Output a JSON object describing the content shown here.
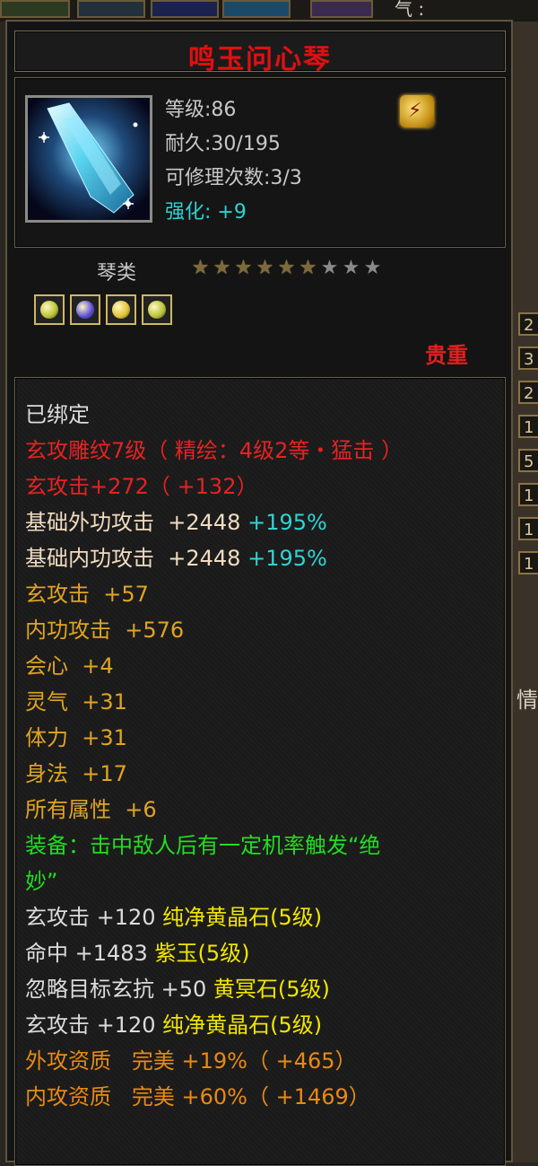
{
  "background": {
    "top_fragment_text": "气 :",
    "right_tabs": [
      "2",
      "3",
      "2",
      "1",
      "5",
      "1",
      "1",
      "1"
    ],
    "right_fragment_text": "情"
  },
  "item": {
    "name": "鸣玉问心琴",
    "level": "等级:86",
    "durability": "耐久:30/195",
    "repair": "可修理次数:3/3",
    "enhance_label": "强化: ",
    "enhance_value": "+9",
    "category": "琴类",
    "stars_filled": 6,
    "stars_total": 9,
    "rarity": "贵重",
    "gem_slots": [
      "yellow-gem",
      "purple-gem",
      "gold-gem",
      "yellow-gem"
    ],
    "badge_icon": "lightning-badge-icon"
  },
  "properties": {
    "bound": "已绑定",
    "engrave": "玄攻雕纹7级（ 精绘：4级2等・猛击 ）",
    "xuan_attack_main": "玄攻击+272（ +132）",
    "base_outer": {
      "label": "基础外功攻击",
      "value": "+2448",
      "pct": "+195%"
    },
    "base_inner": {
      "label": "基础内功攻击",
      "value": "+2448",
      "pct": "+195%"
    },
    "attrs": [
      {
        "label": "玄攻击",
        "value": "+57"
      },
      {
        "label": "内功攻击",
        "value": "+576"
      },
      {
        "label": "会心",
        "value": "+4"
      },
      {
        "label": "灵气",
        "value": "+31"
      },
      {
        "label": "体力",
        "value": "+31"
      },
      {
        "label": "身法",
        "value": "+17"
      },
      {
        "label": "所有属性",
        "value": "+6"
      }
    ],
    "equip_effect_1": "装备：击中敌人后有一定机率触发“绝",
    "equip_effect_2": "妙”",
    "gems": [
      "玄攻击 +120 纯净黄晶石(5级)",
      "命中 +1483 紫玉(5级)",
      "忽略目标玄抗 +50 黄冥石(5级)",
      "玄攻击 +120 纯净黄晶石(5级)"
    ],
    "aptitude": [
      {
        "label": "外攻资质",
        "grade": "完美",
        "value": "+19%（ +465）"
      },
      {
        "label": "内攻资质",
        "grade": "完美",
        "value": "+60%（ +1469）"
      }
    ]
  },
  "colors": {
    "title": "#e01010",
    "rarity": "#e02020",
    "enhance": "#2fd2d2",
    "effect": "#22dc22",
    "gem": "#f2e600",
    "aptitude": "#e88a14"
  }
}
